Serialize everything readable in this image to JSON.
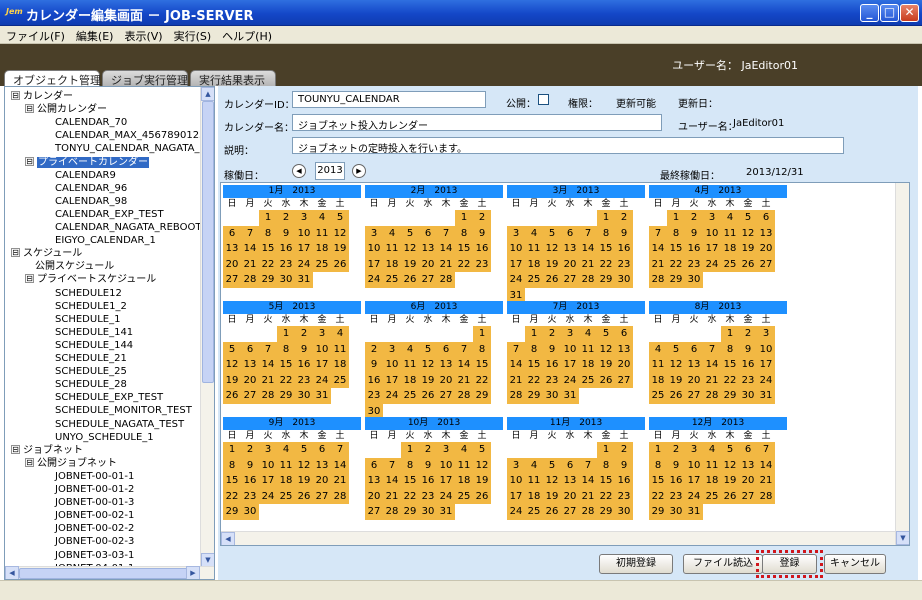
{
  "window": {
    "icon_text": "Jem",
    "title": "カレンダー編集画面 － JOB-SERVER",
    "min": "_",
    "max": "□",
    "close": "✕"
  },
  "menu": [
    "ファイル(F)",
    "編集(E)",
    "表示(V)",
    "実行(S)",
    "ヘルプ(H)"
  ],
  "header": {
    "user": "ユーザー名： JaEditor01"
  },
  "tabs": [
    "オブジェクト管理",
    "ジョブ実行管理",
    "実行結果表示"
  ],
  "tree": [
    {
      "t": "カレンダー",
      "l": 0,
      "tg": "⊟"
    },
    {
      "t": "公開カレンダー",
      "l": 1,
      "tg": "⊟"
    },
    {
      "t": "CALENDAR_70",
      "l": 2
    },
    {
      "t": "CALENDAR_MAX_4567890123456",
      "l": 2
    },
    {
      "t": "TONYU_CALENDAR_NAGATA_PUB",
      "l": 2
    },
    {
      "t": "プライベートカレンダー",
      "l": 1,
      "tg": "⊟",
      "sel": true
    },
    {
      "t": "CALENDAR9",
      "l": 2
    },
    {
      "t": "CALENDAR_96",
      "l": 2
    },
    {
      "t": "CALENDAR_98",
      "l": 2
    },
    {
      "t": "CALENDAR_EXP_TEST",
      "l": 2
    },
    {
      "t": "CALENDAR_NAGATA_REBOOT",
      "l": 2
    },
    {
      "t": "EIGYO_CALENDAR_1",
      "l": 2
    },
    {
      "t": "スケジュール",
      "l": 0,
      "tg": "⊟"
    },
    {
      "t": "公開スケジュール",
      "l": 1
    },
    {
      "t": "プライベートスケジュール",
      "l": 1,
      "tg": "⊟"
    },
    {
      "t": "SCHEDULE12",
      "l": 2
    },
    {
      "t": "SCHEDULE1_2",
      "l": 2
    },
    {
      "t": "SCHEDULE_1",
      "l": 2
    },
    {
      "t": "SCHEDULE_141",
      "l": 2
    },
    {
      "t": "SCHEDULE_144",
      "l": 2
    },
    {
      "t": "SCHEDULE_21",
      "l": 2
    },
    {
      "t": "SCHEDULE_25",
      "l": 2
    },
    {
      "t": "SCHEDULE_28",
      "l": 2
    },
    {
      "t": "SCHEDULE_EXP_TEST",
      "l": 2
    },
    {
      "t": "SCHEDULE_MONITOR_TEST",
      "l": 2
    },
    {
      "t": "SCHEDULE_NAGATA_TEST",
      "l": 2
    },
    {
      "t": "UNYO_SCHEDULE_1",
      "l": 2
    },
    {
      "t": "ジョブネット",
      "l": 0,
      "tg": "⊟"
    },
    {
      "t": "公開ジョブネット",
      "l": 1,
      "tg": "⊟"
    },
    {
      "t": "JOBNET-00-01-1",
      "l": 2
    },
    {
      "t": "JOBNET-00-01-2",
      "l": 2
    },
    {
      "t": "JOBNET-00-01-3",
      "l": 2
    },
    {
      "t": "JOBNET-00-02-1",
      "l": 2
    },
    {
      "t": "JOBNET-00-02-2",
      "l": 2
    },
    {
      "t": "JOBNET-00-02-3",
      "l": 2
    },
    {
      "t": "JOBNET-03-03-1",
      "l": 2
    },
    {
      "t": "JOBNET-04-01-1",
      "l": 2
    }
  ],
  "form": {
    "id_label": "カレンダーID：",
    "id_value": "TOUNYU_CALENDAR",
    "public_label": "公開：",
    "auth_label": "権限：",
    "auth_value": "更新可能",
    "updated_label": "更新日：",
    "updated_value": "",
    "name_label": "カレンダー名：",
    "name_value": "ジョブネット投入カレンダー",
    "user_label": "ユーザー名：",
    "user_value": "JaEditor01",
    "desc_label": "説明：",
    "desc_value": "ジョブネットの定時投入を行います。",
    "opday_label": "稼働日：",
    "year": "2013",
    "last_label": "最終稼働日：",
    "last_value": "2013/12/31"
  },
  "weekdays": [
    "日",
    "月",
    "火",
    "水",
    "木",
    "金",
    "土"
  ],
  "months": [
    {
      "label": "1月　2013",
      "start": 2,
      "days": 31
    },
    {
      "label": "2月　2013",
      "start": 5,
      "days": 28
    },
    {
      "label": "3月　2013",
      "start": 5,
      "days": 31
    },
    {
      "label": "4月　2013",
      "start": 1,
      "days": 30
    },
    {
      "label": "5月　2013",
      "start": 3,
      "days": 31
    },
    {
      "label": "6月　2013",
      "start": 6,
      "days": 30
    },
    {
      "label": "7月　2013",
      "start": 1,
      "days": 31
    },
    {
      "label": "8月　2013",
      "start": 4,
      "days": 31
    },
    {
      "label": "9月　2013",
      "start": 0,
      "days": 30
    },
    {
      "label": "10月　2013",
      "start": 2,
      "days": 31
    },
    {
      "label": "11月　2013",
      "start": 5,
      "days": 30
    },
    {
      "label": "12月　2013",
      "start": 0,
      "days": 31
    }
  ],
  "buttons": {
    "init": "初期登録",
    "file": "ファイル読込",
    "register": "登録",
    "cancel": "キャンセル"
  }
}
